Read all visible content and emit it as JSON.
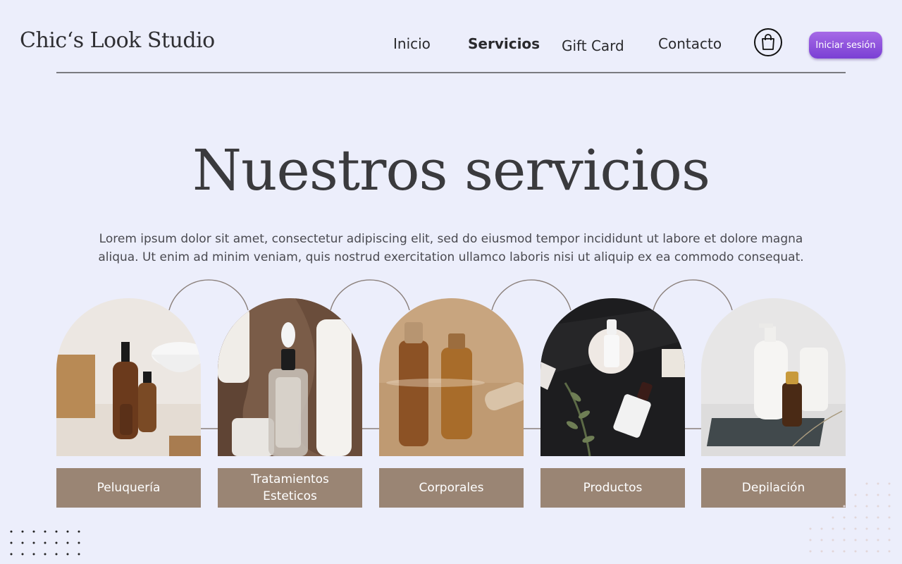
{
  "header": {
    "logo": "Chic‘s Look Studio",
    "nav": [
      "Inicio",
      "Servicios",
      "Gift Card",
      "Contacto"
    ],
    "active": "Servicios",
    "login_label": "Iniciar sesión"
  },
  "hero": {
    "title": "Nuestros servicios",
    "text": "Lorem ipsum dolor sit amet, consectetur adipiscing elit, sed do eiusmod tempor incididunt ut labore et dolore magna aliqua. Ut enim ad minim veniam, quis nostrud exercitation ullamco laboris nisi ut aliquip ex ea commodo consequat."
  },
  "services": [
    {
      "label": "Peluquería"
    },
    {
      "label": "Tratamientos Esteticos"
    },
    {
      "label": "Corporales"
    },
    {
      "label": "Productos"
    },
    {
      "label": "Depilación"
    }
  ],
  "colors": {
    "background": "#eceefb",
    "label_bg": "#9a8574",
    "button": "#8b4fe0"
  }
}
